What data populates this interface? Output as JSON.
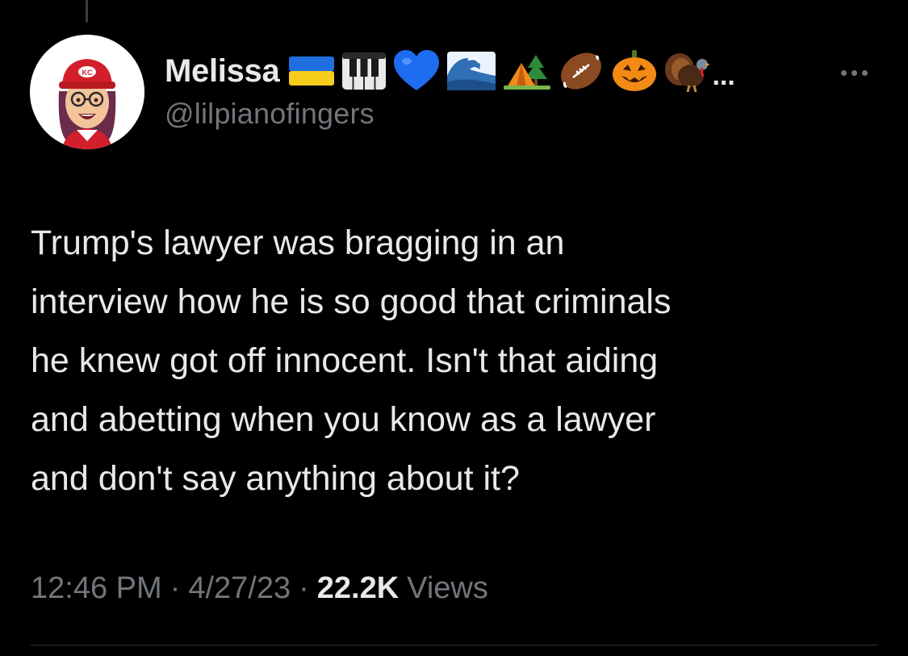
{
  "author": {
    "display_name": "Melissa",
    "handle": "@lilpianofingers",
    "name_overflow": "...",
    "name_emojis": [
      "ukraine-flag",
      "piano-keys",
      "blue-heart",
      "wave",
      "camping-tent",
      "american-football",
      "jack-o-lantern",
      "turkey"
    ]
  },
  "tweet": {
    "text_lines": [
      "Trump's lawyer was bragging in an",
      "interview how he is so good that criminals",
      "he knew got off innocent. Isn't that aiding",
      "and abetting when you know as a lawyer",
      "and don't say anything about it?"
    ],
    "time": "12:46 PM",
    "date": "4/27/23",
    "separator": "·",
    "views_count": "22.2K",
    "views_label": "Views"
  },
  "colors": {
    "background": "#000000",
    "primary_text": "#e7e9ea",
    "secondary_text": "#71767b",
    "divider": "#2f3336"
  }
}
